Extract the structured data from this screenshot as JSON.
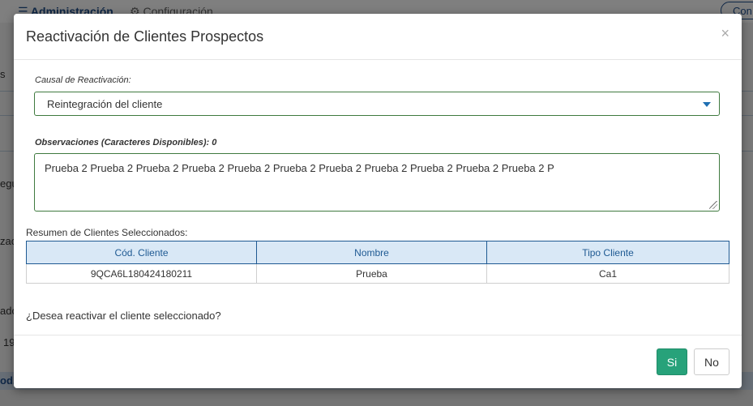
{
  "background": {
    "nav": {
      "admin": "Administración",
      "config": "Configuración",
      "pill": "Con"
    },
    "side_fragments": [
      "s",
      "egu",
      "zac",
      "ado",
      "19",
      "od."
    ]
  },
  "modal": {
    "title": "Reactivación de Clientes Prospectos",
    "close": "×",
    "causal_label": "Causal de Reactivación:",
    "causal_value": "Reintegración del cliente",
    "obs_label": "Observaciones (Caracteres Disponibles): 0",
    "obs_value": "Prueba 2 Prueba 2 Prueba 2 Prueba 2 Prueba 2 Prueba 2 Prueba 2 Prueba 2 Prueba 2 Prueba 2 Prueba 2 P",
    "summary_label": "Resumen de Clientes Seleccionados:",
    "table": {
      "headers": [
        "Cód. Cliente",
        "Nombre",
        "Tipo Cliente"
      ],
      "rows": [
        [
          "9QCA6L180424180211",
          "Prueba",
          "Ca1"
        ]
      ]
    },
    "question": "¿Desea reactivar el cliente seleccionado?",
    "btn_yes": "Si",
    "btn_no": "No"
  },
  "colors": {
    "accent_green": "#27a27a",
    "header_blue": "#1f5a93",
    "field_border": "#3f7a3f"
  }
}
